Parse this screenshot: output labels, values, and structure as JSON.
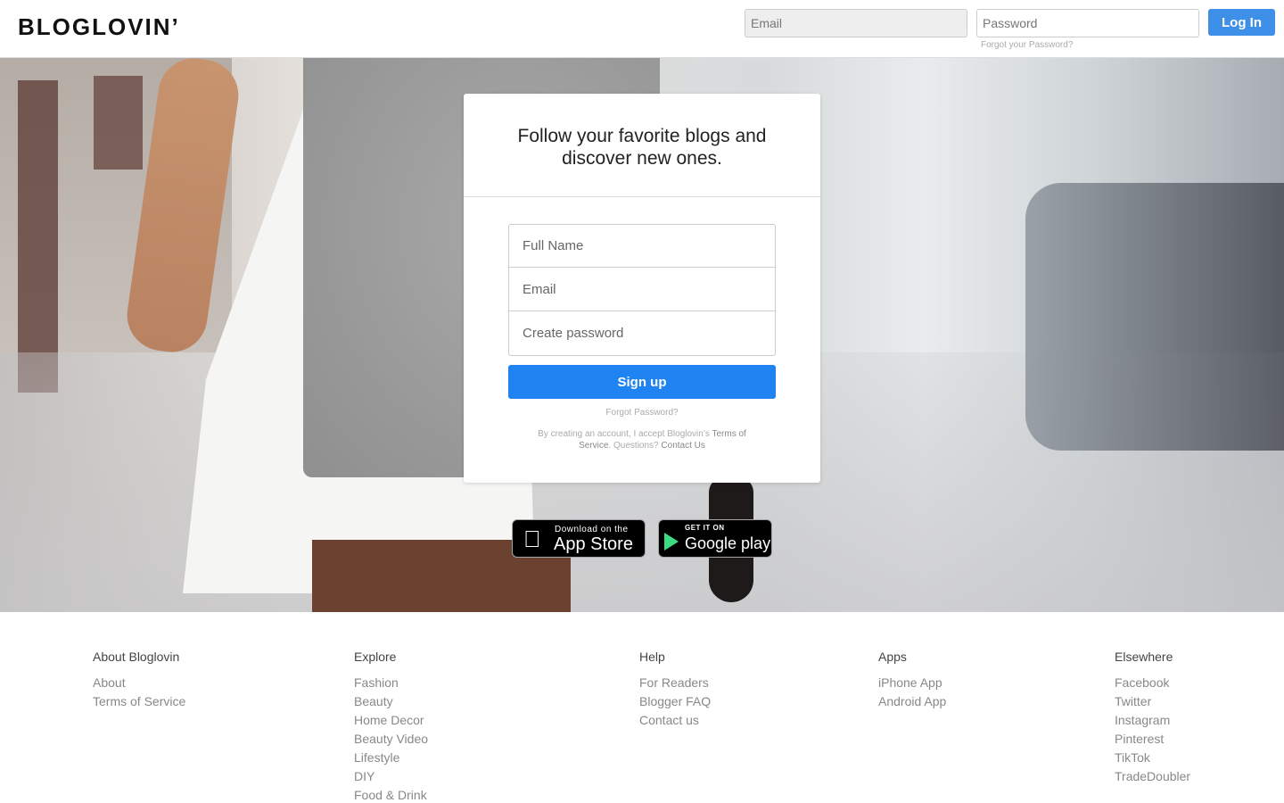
{
  "header": {
    "logo": "BLOGLOVIN’",
    "email_placeholder": "Email",
    "password_placeholder": "Password",
    "login_label": "Log In",
    "forgot_label": "Forgot your Password?"
  },
  "signup": {
    "title": "Follow your favorite blogs and discover new ones.",
    "fullname_placeholder": "Full Name",
    "email_placeholder": "Email",
    "password_placeholder": "Create password",
    "signup_label": "Sign up",
    "forgot_label": "Forgot Password?",
    "terms_prefix": "By creating an account, I accept Bloglovin’s",
    "terms_link": "Terms of Service",
    "questions": ". Questions?",
    "contact_link": "Contact Us"
  },
  "badges": {
    "appstore_small": "Download on the",
    "appstore_big": "App Store",
    "googleplay_small": "GET IT ON",
    "googleplay_big": "Google play"
  },
  "footer": {
    "columns": [
      {
        "heading": "About Bloglovin",
        "links": [
          "About",
          "Terms of Service"
        ]
      },
      {
        "heading": "Explore",
        "links": [
          "Fashion",
          "Beauty",
          "Home Decor",
          "Beauty Video",
          "Lifestyle",
          "DIY",
          "Food & Drink"
        ]
      },
      {
        "heading": "Help",
        "links": [
          "For Readers",
          "Blogger FAQ",
          "Contact us"
        ]
      },
      {
        "heading": "Apps",
        "links": [
          "iPhone App",
          "Android App"
        ]
      },
      {
        "heading": "Elsewhere",
        "links": [
          "Facebook",
          "Twitter",
          "Instagram",
          "Pinterest",
          "TikTok",
          "TradeDoubler"
        ]
      }
    ]
  }
}
